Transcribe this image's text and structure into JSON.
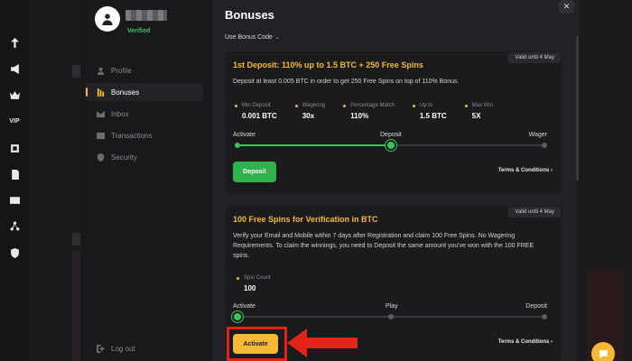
{
  "rail": {
    "items": [
      {
        "name": "sports-icon",
        "label": ""
      },
      {
        "name": "promotions-icon",
        "label": ""
      },
      {
        "name": "crown-icon",
        "label": ""
      },
      {
        "name": "vip-icon",
        "label": "VIP"
      },
      {
        "name": "casino-icon",
        "label": ""
      },
      {
        "name": "document-icon",
        "label": ""
      },
      {
        "name": "wallet-icon",
        "label": ""
      },
      {
        "name": "network-icon",
        "label": ""
      },
      {
        "name": "shield-icon",
        "label": ""
      }
    ]
  },
  "profile": {
    "verified_label": "Verified"
  },
  "sidebar": {
    "items": [
      {
        "label": "Profile",
        "icon": "user-icon",
        "active": false
      },
      {
        "label": "Bonuses",
        "icon": "bonus-icon",
        "active": true
      },
      {
        "label": "Inbox",
        "icon": "mail-icon",
        "active": false
      },
      {
        "label": "Transactions",
        "icon": "transactions-icon",
        "active": false
      },
      {
        "label": "Security",
        "icon": "security-icon",
        "active": false
      }
    ],
    "logout_label": "Log out"
  },
  "header": {
    "title": "Bonuses",
    "bonus_code_label": "Use Bonus Code",
    "close_label": "✕"
  },
  "cards": [
    {
      "valid_until": "Valid until 4 May",
      "title": "1st Deposit: 110% up to 1.5 BTC + 250 Free Spins",
      "description": "Deposit at least 0.005 BTC in order to get 250 Free Spins on top of 110% Bonus.",
      "stats": [
        {
          "label": "Min Deposit",
          "value": "0.001 BTC"
        },
        {
          "label": "Wagering",
          "value": "30x"
        },
        {
          "label": "Percentage Match",
          "value": "110%"
        },
        {
          "label": "Up to",
          "value": "1.5 BTC"
        },
        {
          "label": "Max Win",
          "value": "5X"
        }
      ],
      "progress_labels": [
        "Activate",
        "Deposit",
        "Wager"
      ],
      "progress_fraction": 0.5,
      "button_label": "Deposit",
      "terms_label": "Terms & Conditions ›"
    },
    {
      "valid_until": "Valid until 4 May",
      "title": "100 Free Spins for Verification in BTC",
      "description": "Verify your Email and Mobile within 7 days after Registration and claim 100 Free Spins. No Wagering Requirements. To claim the winnings, you need to Deposit the same amount you've won with the 100 FREE spins.",
      "stats": [
        {
          "label": "Spin Count",
          "value": "100"
        }
      ],
      "progress_labels": [
        "Activate",
        "Play",
        "Deposit"
      ],
      "progress_fraction": 0.0,
      "button_label": "Activate",
      "terms_label": "Terms & Conditions ›"
    }
  ],
  "colors": {
    "accent": "#f5b935",
    "success": "#3bc35b",
    "annotation": "#e2231a",
    "panel": "#222226",
    "card": "#1b1b1e"
  }
}
